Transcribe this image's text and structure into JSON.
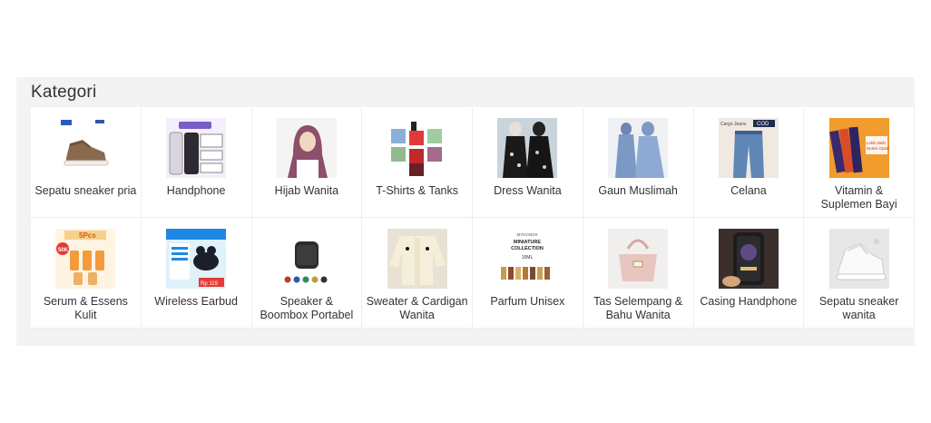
{
  "section_title": "Kategori",
  "categories": [
    {
      "label": "Sepatu sneaker pria",
      "icon": "sneaker-icon"
    },
    {
      "label": "Handphone",
      "icon": "phone-icon"
    },
    {
      "label": "Hijab Wanita",
      "icon": "hijab-icon"
    },
    {
      "label": "T-Shirts & Tanks",
      "icon": "tshirt-icon"
    },
    {
      "label": "Dress Wanita",
      "icon": "dress-icon"
    },
    {
      "label": "Gaun Muslimah",
      "icon": "gown-icon"
    },
    {
      "label": "Celana",
      "icon": "pants-icon"
    },
    {
      "label": "Vitamin & Suplemen Bayi",
      "icon": "vitamin-icon"
    },
    {
      "label": "Serum & Essens Kulit",
      "icon": "serum-icon"
    },
    {
      "label": "Wireless Earbud",
      "icon": "earbud-icon"
    },
    {
      "label": "Speaker & Boombox Portabel",
      "icon": "speaker-icon"
    },
    {
      "label": "Sweater & Cardigan Wanita",
      "icon": "sweater-icon"
    },
    {
      "label": "Parfum Unisex",
      "icon": "perfume-icon"
    },
    {
      "label": "Tas Selempang & Bahu Wanita",
      "icon": "bag-icon"
    },
    {
      "label": "Casing Handphone",
      "icon": "phone-case-icon"
    },
    {
      "label": "Sepatu sneaker wanita",
      "icon": "sneaker-icon"
    }
  ],
  "image_text": {
    "vitamin_caption": "Lebih Bafit, Nutrisi Optimal!",
    "serum_badge": "50K",
    "serum_title": "5Pcs",
    "earbud_price": "Rp 119",
    "perfume_brand": "MYKONOS",
    "perfume_title": "MINIATURE COLLECTION",
    "perfume_size": "15ML",
    "pants_badge": "COD",
    "pants_caption": "Cargo Jeans"
  }
}
